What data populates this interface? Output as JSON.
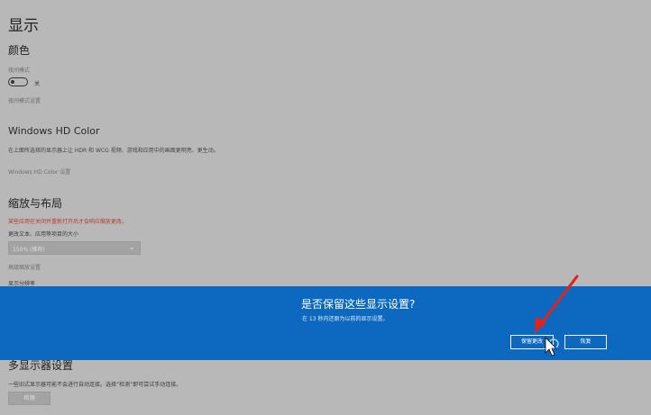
{
  "page": {
    "title": "显示",
    "color": {
      "heading": "颜色",
      "night_light_label": "夜间模式",
      "night_light_state": "关",
      "night_light_settings_link": "夜间模式设置"
    },
    "hd_color": {
      "heading": "Windows HD Color",
      "description": "在上面所选择的显示器上让 HDR 和 WCG 视频、游戏和应用中的画面更明亮、更生动。",
      "settings_link": "Windows HD Color 设置"
    },
    "scale": {
      "heading": "缩放与布局",
      "warning": "某些应用在关闭并重新打开后才会响应缩放更改。",
      "size_label": "更改文本、应用等项目的大小",
      "size_value": "150% (推荐)",
      "advanced_link": "高级缩放设置",
      "resolution_label": "显示分辨率"
    },
    "multi": {
      "heading": "多显示器设置",
      "description": "一些旧式显示器可能不会进行自动连接。选择“检测”即可尝试手动连接。",
      "detect_button": "检测"
    }
  },
  "dialog": {
    "question": "是否保留这些显示设置?",
    "subtext": "在 13 秒内还原为以前的显示设置。",
    "keep_button": "保留更改",
    "revert_button": "恢复",
    "accent_color": "#0c69bf"
  },
  "annotation": {
    "arrow_color": "#e8201a"
  }
}
